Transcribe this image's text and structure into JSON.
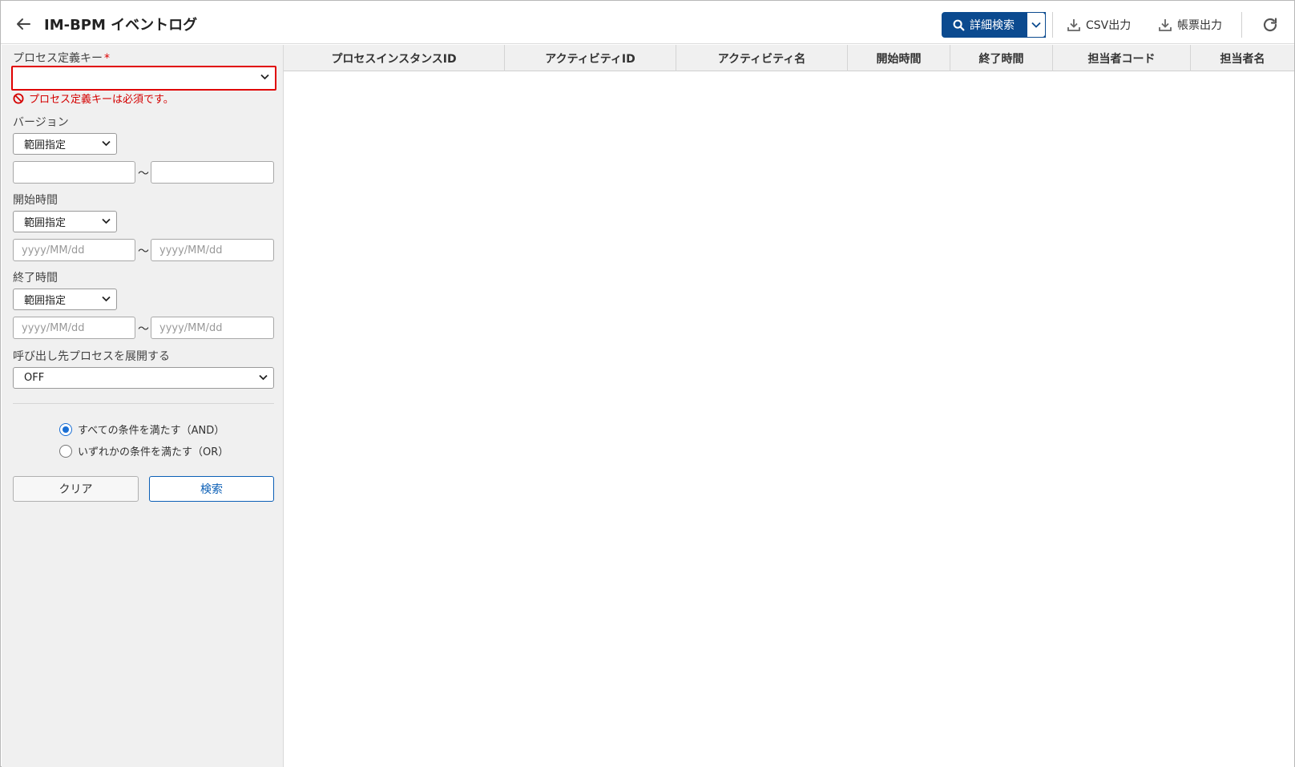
{
  "header": {
    "title": "IM-BPM イベントログ",
    "advanced_search_label": "詳細検索",
    "csv_export_label": "CSV出力",
    "report_export_label": "帳票出力"
  },
  "search_form": {
    "process_key": {
      "label": "プロセス定義キー",
      "required_mark": "*",
      "value": "",
      "error": "プロセス定義キーは必須です。"
    },
    "version": {
      "label": "バージョン",
      "mode": "範囲指定",
      "from_value": "",
      "to_value": ""
    },
    "start_time": {
      "label": "開始時間",
      "mode": "範囲指定",
      "from_placeholder": "yyyy/MM/dd",
      "to_placeholder": "yyyy/MM/dd"
    },
    "end_time": {
      "label": "終了時間",
      "mode": "範囲指定",
      "from_placeholder": "yyyy/MM/dd",
      "to_placeholder": "yyyy/MM/dd"
    },
    "range_separator": "〜",
    "expand_called": {
      "label": "呼び出し先プロセスを展開する",
      "value": "OFF"
    },
    "match_options": [
      {
        "label": "すべての条件を満たす（AND）",
        "checked": true
      },
      {
        "label": "いずれかの条件を満たす（OR）",
        "checked": false
      }
    ],
    "clear_label": "クリア",
    "search_label": "検索"
  },
  "table": {
    "columns": [
      "プロセスインスタンスID",
      "アクティビティID",
      "アクティビティ名",
      "開始時間",
      "終了時間",
      "担当者コード",
      "担当者名"
    ],
    "rows": []
  },
  "colors": {
    "primary": "#0b4a8f",
    "error": "#e00000",
    "sidebar_bg": "#f0f0f0"
  }
}
